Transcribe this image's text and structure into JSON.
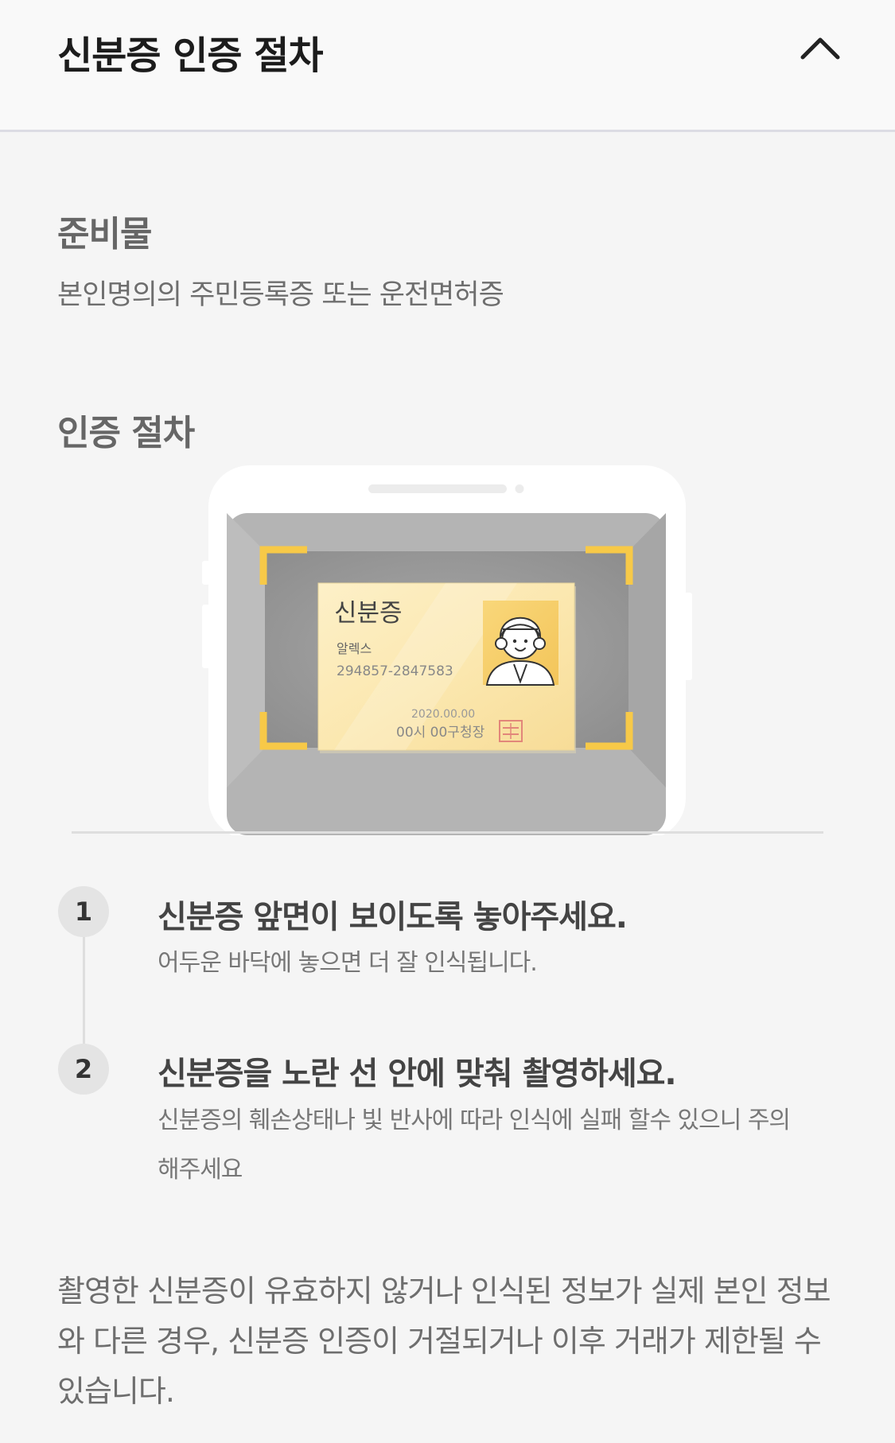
{
  "header": {
    "title": "신분증 인증 절차",
    "toggle_icon": "chevron-up-icon"
  },
  "prep": {
    "title": "준비물",
    "description": "본인명의의 주민등록증 또는 운전면허증"
  },
  "procedure": {
    "title": "인증 절차"
  },
  "id_card": {
    "title": "신분증",
    "name": "알렉스",
    "number": "294857-2847583",
    "date": "2020.00.00",
    "issuer": "00시 00구청장",
    "accent_color": "#f7c948"
  },
  "steps": [
    {
      "number": "1",
      "title": "신분증 앞면이 보이도록 놓아주세요.",
      "description": "어두운 바닥에 놓으면 더 잘 인식됩니다."
    },
    {
      "number": "2",
      "title": "신분증을 노란 선 안에 맞춰 촬영하세요.",
      "description": "신분증의 훼손상태나 빛 반사에 따라 인식에 실패 할수 있으니 주의해주세요"
    }
  ],
  "notice": "촬영한 신분증이 유효하지 않거나 인식된 정보가 실제 본인 정보와 다른 경우, 신분증 인증이 거절되거나 이후 거래가 제한될 수 있습니다."
}
